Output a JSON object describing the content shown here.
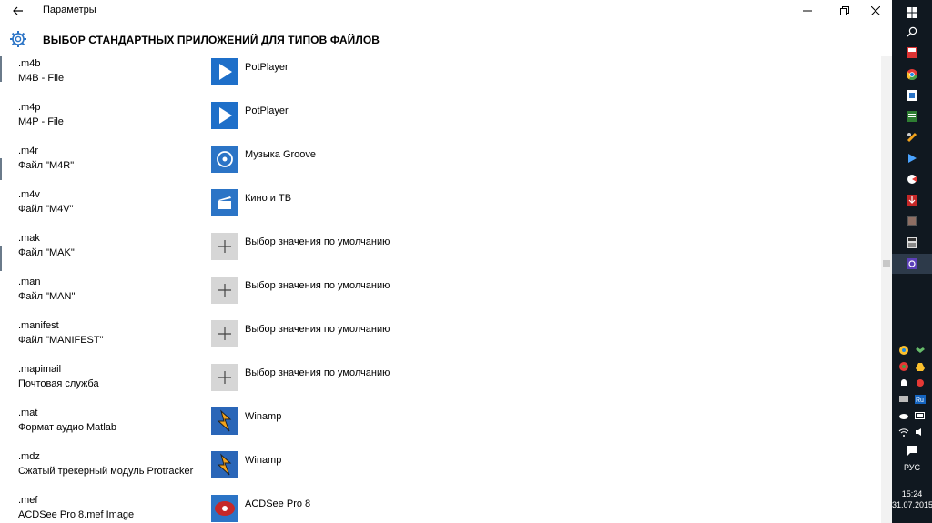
{
  "window": {
    "title": "Параметры",
    "header_title": "ВЫБОР СТАНДАРТНЫХ ПРИЛОЖЕНИЙ ДЛЯ ТИПОВ ФАЙЛОВ"
  },
  "rows": [
    {
      "ext": ".m4b",
      "desc": "M4B - File",
      "app": "PotPlayer",
      "icon": "potplayer-icon"
    },
    {
      "ext": ".m4p",
      "desc": "M4P - File",
      "app": "PotPlayer",
      "icon": "potplayer-icon"
    },
    {
      "ext": ".m4r",
      "desc": "Файл \"M4R\"",
      "app": "Музыка Groove",
      "icon": "groove-music-icon"
    },
    {
      "ext": ".m4v",
      "desc": "Файл \"M4V\"",
      "app": "Кино и ТВ",
      "icon": "movies-tv-icon"
    },
    {
      "ext": ".mak",
      "desc": "Файл \"MAK\"",
      "app": "Выбор значения по умолчанию",
      "icon": "plus-icon"
    },
    {
      "ext": ".man",
      "desc": "Файл \"MAN\"",
      "app": "Выбор значения по умолчанию",
      "icon": "plus-icon"
    },
    {
      "ext": ".manifest",
      "desc": "Файл \"MANIFEST\"",
      "app": "Выбор значения по умолчанию",
      "icon": "plus-icon"
    },
    {
      "ext": ".mapimail",
      "desc": "Почтовая служба",
      "app": "Выбор значения по умолчанию",
      "icon": "plus-icon"
    },
    {
      "ext": ".mat",
      "desc": "Формат аудио Matlab",
      "app": "Winamp",
      "icon": "winamp-icon"
    },
    {
      "ext": ".mdz",
      "desc": "Сжатый трекерный модуль Protracker",
      "app": "Winamp",
      "icon": "winamp-icon"
    },
    {
      "ext": ".mef",
      "desc": "ACDSee Pro 8.mef Image",
      "app": "ACDSee Pro 8",
      "icon": "acdsee-icon"
    }
  ],
  "taskbar": {
    "language": "РУС",
    "time": "15:24",
    "date": "31.07.2015"
  },
  "colors": {
    "accent": "#2b74c6",
    "potplayer": "#1e6fc9",
    "winamp": "#2a66b8",
    "acdsee": "#c62828",
    "plus_tile": "#d6d6d6",
    "taskbar": "#101820"
  }
}
